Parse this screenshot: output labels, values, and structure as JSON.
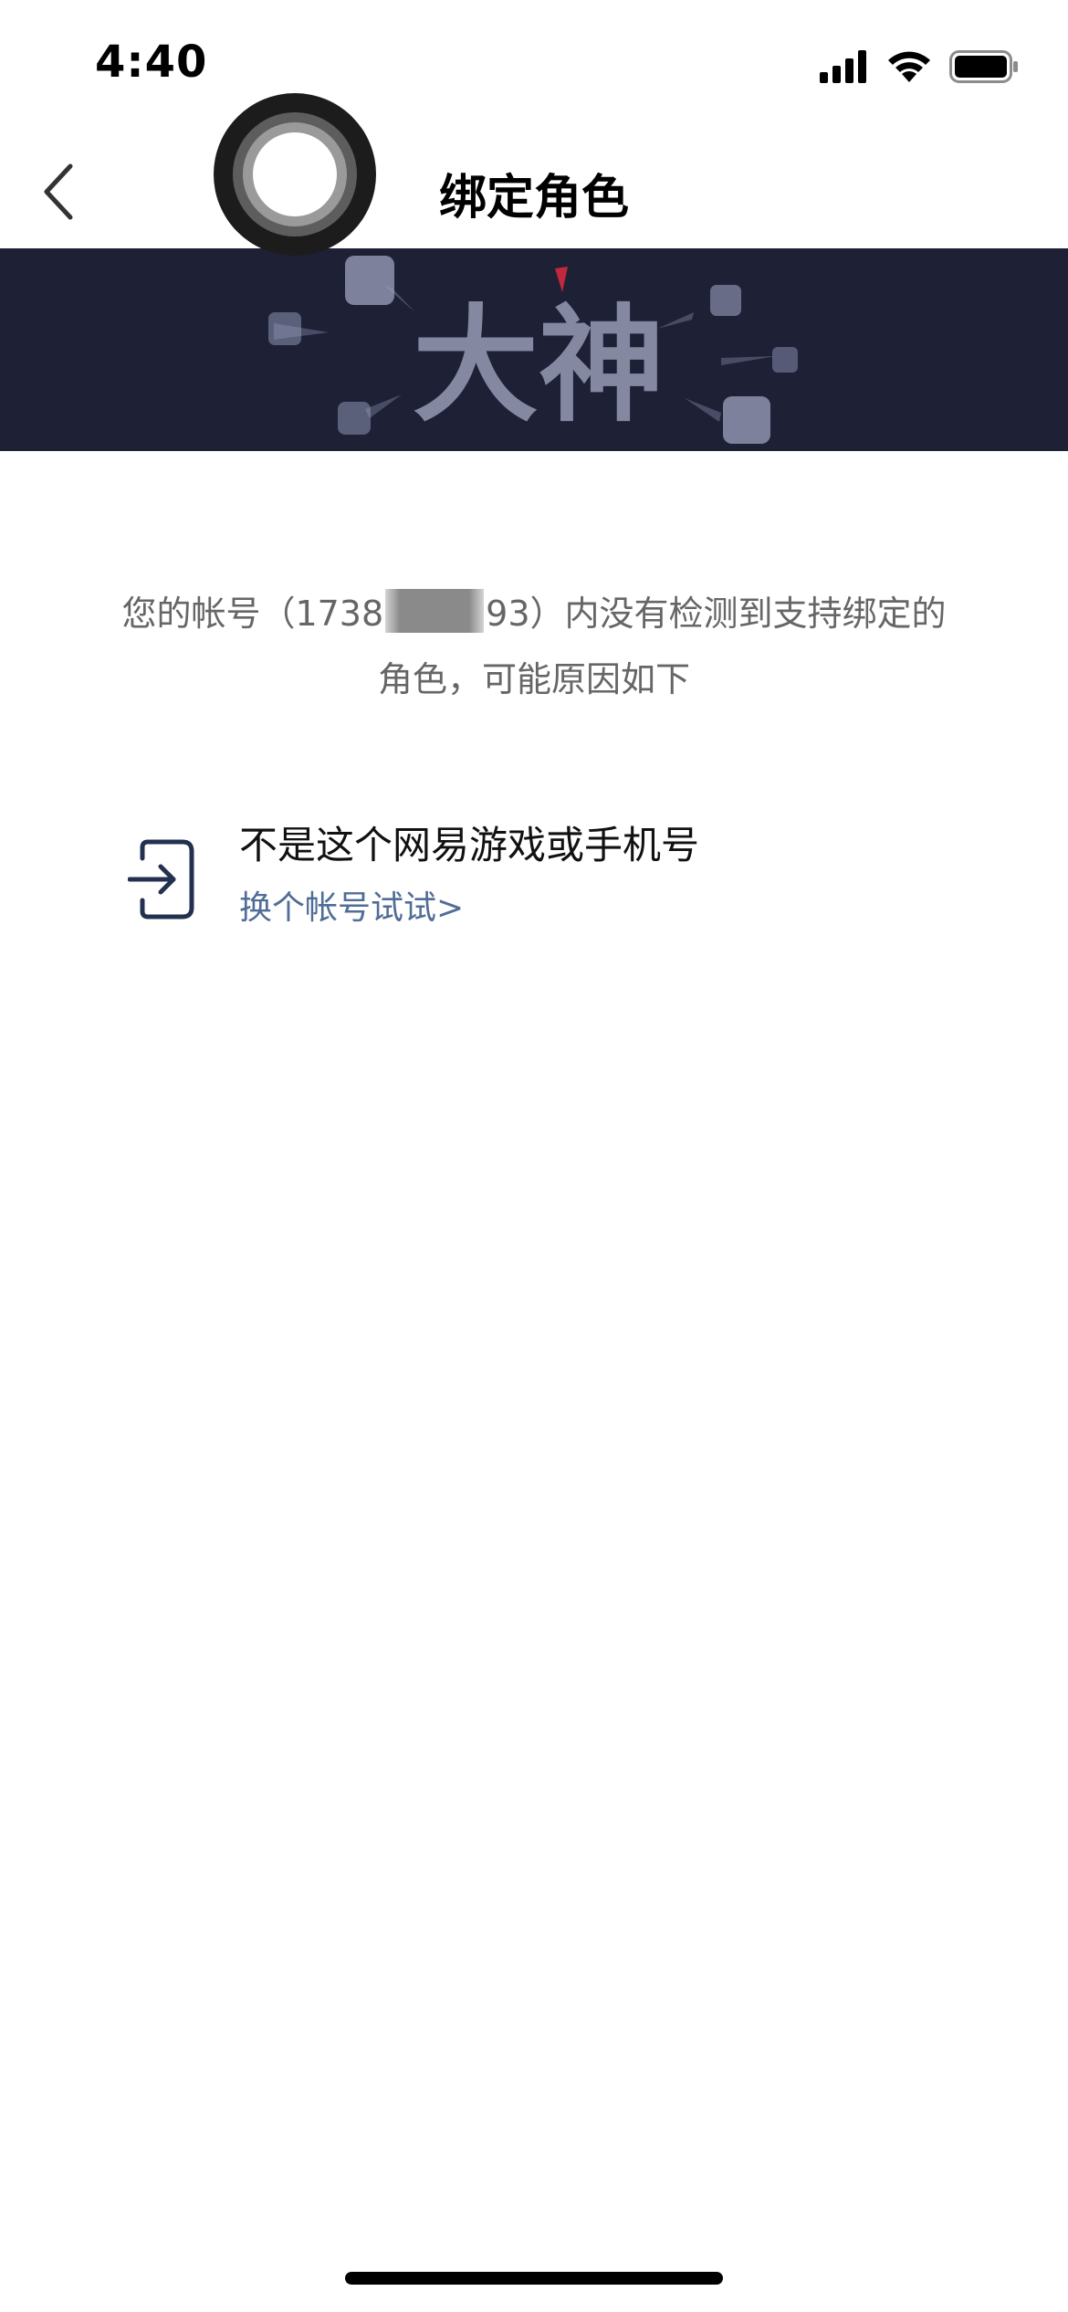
{
  "status_bar": {
    "time": "4:40",
    "icons": [
      "cellular-signal-icon",
      "wifi-icon",
      "battery-icon"
    ]
  },
  "nav": {
    "back_icon": "chevron-left-icon",
    "title": "绑定角色"
  },
  "banner": {
    "logo_text": "大神",
    "background_color": "#1e2036"
  },
  "message": {
    "prefix": "您的帐号（1738",
    "suffix": "93）内没有检测到支持绑定的",
    "line2": "角色，可能原因如下"
  },
  "reason": {
    "icon": "sign-in-icon",
    "title": "不是这个网易游戏或手机号",
    "link": "换个帐号试试>",
    "link_color": "#4f6d96"
  }
}
